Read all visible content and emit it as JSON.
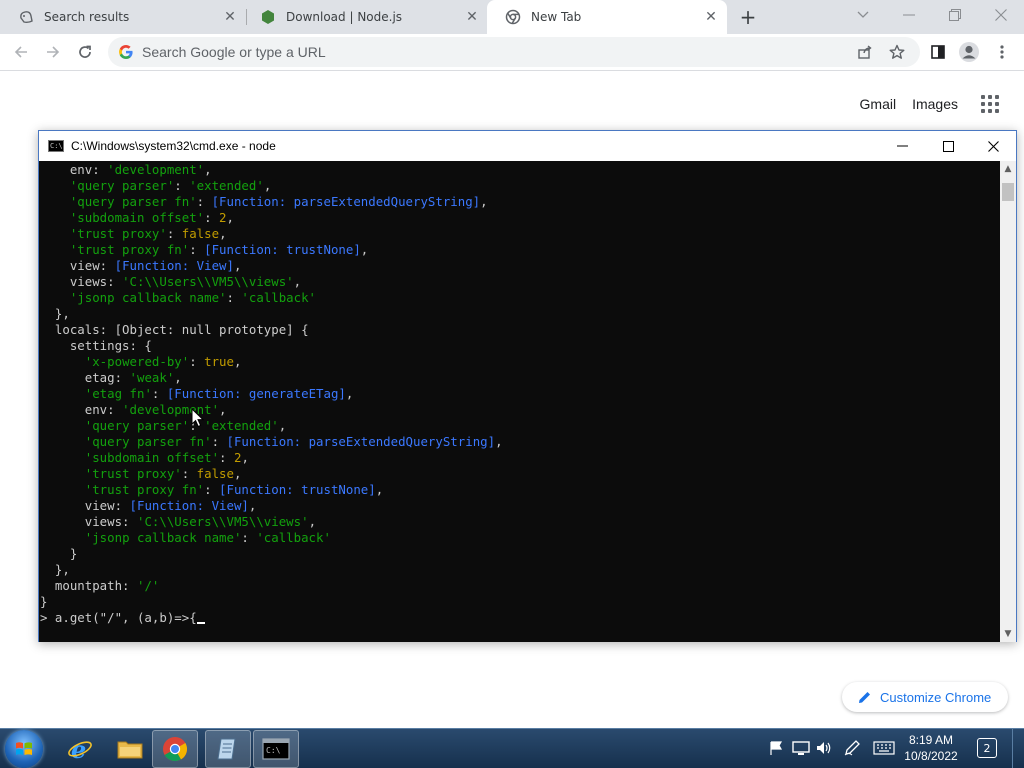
{
  "browser": {
    "tabs": [
      {
        "title": "Search results",
        "favicon": "search-favicon",
        "active": false
      },
      {
        "title": "Download | Node.js",
        "favicon": "nodejs-favicon",
        "active": false
      },
      {
        "title": "New Tab",
        "favicon": "chrome-favicon",
        "active": true
      }
    ],
    "omnibox": {
      "placeholder": "Search Google or type a URL",
      "value": ""
    },
    "ntp": {
      "gmail_label": "Gmail",
      "images_label": "Images",
      "customize_label": "Customize Chrome"
    }
  },
  "cmd": {
    "title": "C:\\Windows\\system32\\cmd.exe - node",
    "icon_text": "C:\\",
    "lines": [
      [
        {
          "t": "    env: ",
          "c": "d"
        },
        {
          "t": "'development'",
          "c": "str"
        },
        {
          "t": ",",
          "c": "d"
        }
      ],
      [
        {
          "t": "    ",
          "c": "d"
        },
        {
          "t": "'query parser'",
          "c": "str"
        },
        {
          "t": ": ",
          "c": "d"
        },
        {
          "t": "'extended'",
          "c": "str"
        },
        {
          "t": ",",
          "c": "d"
        }
      ],
      [
        {
          "t": "    ",
          "c": "d"
        },
        {
          "t": "'query parser fn'",
          "c": "str"
        },
        {
          "t": ": ",
          "c": "d"
        },
        {
          "t": "[Function: parseExtendedQueryString]",
          "c": "fn"
        },
        {
          "t": ",",
          "c": "d"
        }
      ],
      [
        {
          "t": "    ",
          "c": "d"
        },
        {
          "t": "'subdomain offset'",
          "c": "str"
        },
        {
          "t": ": ",
          "c": "d"
        },
        {
          "t": "2",
          "c": "num"
        },
        {
          "t": ",",
          "c": "d"
        }
      ],
      [
        {
          "t": "    ",
          "c": "d"
        },
        {
          "t": "'trust proxy'",
          "c": "str"
        },
        {
          "t": ": ",
          "c": "d"
        },
        {
          "t": "false",
          "c": "bool"
        },
        {
          "t": ",",
          "c": "d"
        }
      ],
      [
        {
          "t": "    ",
          "c": "d"
        },
        {
          "t": "'trust proxy fn'",
          "c": "str"
        },
        {
          "t": ": ",
          "c": "d"
        },
        {
          "t": "[Function: trustNone]",
          "c": "fn"
        },
        {
          "t": ",",
          "c": "d"
        }
      ],
      [
        {
          "t": "    view: ",
          "c": "d"
        },
        {
          "t": "[Function: View]",
          "c": "fn"
        },
        {
          "t": ",",
          "c": "d"
        }
      ],
      [
        {
          "t": "    views: ",
          "c": "d"
        },
        {
          "t": "'C:\\\\Users\\\\VM5\\\\views'",
          "c": "str"
        },
        {
          "t": ",",
          "c": "d"
        }
      ],
      [
        {
          "t": "    ",
          "c": "d"
        },
        {
          "t": "'jsonp callback name'",
          "c": "str"
        },
        {
          "t": ": ",
          "c": "d"
        },
        {
          "t": "'callback'",
          "c": "str"
        }
      ],
      [
        {
          "t": "  },",
          "c": "d"
        }
      ],
      [
        {
          "t": "  locals: [Object: null prototype] {",
          "c": "d"
        }
      ],
      [
        {
          "t": "    settings: {",
          "c": "d"
        }
      ],
      [
        {
          "t": "      ",
          "c": "d"
        },
        {
          "t": "'x-powered-by'",
          "c": "str"
        },
        {
          "t": ": ",
          "c": "d"
        },
        {
          "t": "true",
          "c": "bool"
        },
        {
          "t": ",",
          "c": "d"
        }
      ],
      [
        {
          "t": "      etag: ",
          "c": "d"
        },
        {
          "t": "'weak'",
          "c": "str"
        },
        {
          "t": ",",
          "c": "d"
        }
      ],
      [
        {
          "t": "      ",
          "c": "d"
        },
        {
          "t": "'etag fn'",
          "c": "str"
        },
        {
          "t": ": ",
          "c": "d"
        },
        {
          "t": "[Function: generateETag]",
          "c": "fn"
        },
        {
          "t": ",",
          "c": "d"
        }
      ],
      [
        {
          "t": "      env: ",
          "c": "d"
        },
        {
          "t": "'development'",
          "c": "str"
        },
        {
          "t": ",",
          "c": "d"
        }
      ],
      [
        {
          "t": "      ",
          "c": "d"
        },
        {
          "t": "'query parser'",
          "c": "str"
        },
        {
          "t": ": ",
          "c": "d"
        },
        {
          "t": "'extended'",
          "c": "str"
        },
        {
          "t": ",",
          "c": "d"
        }
      ],
      [
        {
          "t": "      ",
          "c": "d"
        },
        {
          "t": "'query parser fn'",
          "c": "str"
        },
        {
          "t": ": ",
          "c": "d"
        },
        {
          "t": "[Function: parseExtendedQueryString]",
          "c": "fn"
        },
        {
          "t": ",",
          "c": "d"
        }
      ],
      [
        {
          "t": "      ",
          "c": "d"
        },
        {
          "t": "'subdomain offset'",
          "c": "str"
        },
        {
          "t": ": ",
          "c": "d"
        },
        {
          "t": "2",
          "c": "num"
        },
        {
          "t": ",",
          "c": "d"
        }
      ],
      [
        {
          "t": "      ",
          "c": "d"
        },
        {
          "t": "'trust proxy'",
          "c": "str"
        },
        {
          "t": ": ",
          "c": "d"
        },
        {
          "t": "false",
          "c": "bool"
        },
        {
          "t": ",",
          "c": "d"
        }
      ],
      [
        {
          "t": "      ",
          "c": "d"
        },
        {
          "t": "'trust proxy fn'",
          "c": "str"
        },
        {
          "t": ": ",
          "c": "d"
        },
        {
          "t": "[Function: trustNone]",
          "c": "fn"
        },
        {
          "t": ",",
          "c": "d"
        }
      ],
      [
        {
          "t": "      view: ",
          "c": "d"
        },
        {
          "t": "[Function: View]",
          "c": "fn"
        },
        {
          "t": ",",
          "c": "d"
        }
      ],
      [
        {
          "t": "      views: ",
          "c": "d"
        },
        {
          "t": "'C:\\\\Users\\\\VM5\\\\views'",
          "c": "str"
        },
        {
          "t": ",",
          "c": "d"
        }
      ],
      [
        {
          "t": "      ",
          "c": "d"
        },
        {
          "t": "'jsonp callback name'",
          "c": "str"
        },
        {
          "t": ": ",
          "c": "d"
        },
        {
          "t": "'callback'",
          "c": "str"
        }
      ],
      [
        {
          "t": "    }",
          "c": "d"
        }
      ],
      [
        {
          "t": "  },",
          "c": "d"
        }
      ],
      [
        {
          "t": "  mountpath: ",
          "c": "d"
        },
        {
          "t": "'/'",
          "c": "str"
        }
      ],
      [
        {
          "t": "}",
          "c": "d"
        }
      ],
      [
        {
          "t": "> a.get(\"/\", (a,b)=>{",
          "c": "d"
        }
      ]
    ],
    "colors": {
      "str": "#13a10e",
      "bool": "#c19c00",
      "num": "#c19c00",
      "fn": "#3b78ff",
      "d": "#cccccc"
    }
  },
  "taskbar": {
    "apps": [
      "internet-explorer",
      "file-explorer",
      "chrome",
      "notepad",
      "cmd"
    ],
    "time": "8:19 AM",
    "date": "10/8/2022",
    "notification_count": "2"
  }
}
